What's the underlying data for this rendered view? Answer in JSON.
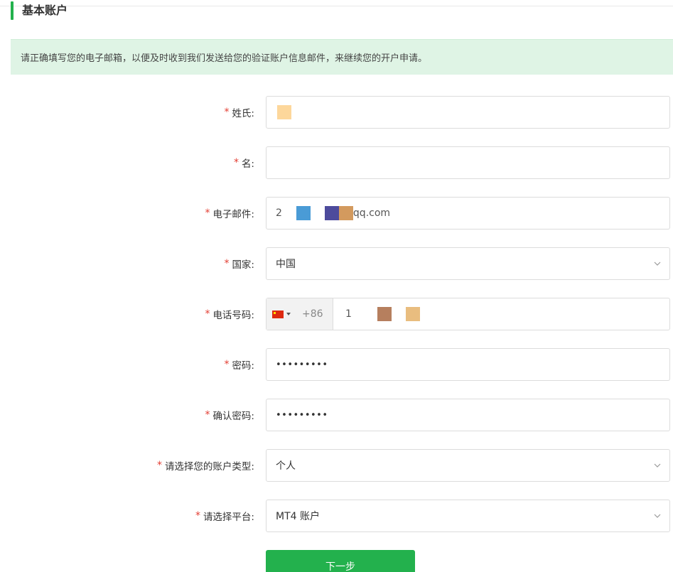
{
  "section": {
    "title": "基本账户"
  },
  "notice": {
    "text": "请正确填写您的电子邮箱，以便及时收到我们发送给您的验证账户信息邮件，来继续您的开户申请。"
  },
  "form": {
    "required_mark": "*",
    "last_name": {
      "label": "姓氏:",
      "value": ""
    },
    "first_name": {
      "label": "名:",
      "value": ""
    },
    "email": {
      "label": "电子邮件:",
      "value_prefix": "2",
      "value_suffix": "qq.com"
    },
    "country": {
      "label": "国家:",
      "value": "中国"
    },
    "phone": {
      "label": "电话号码:",
      "flag_icon": "china-flag-icon",
      "country_code": "+86",
      "value_prefix": "1"
    },
    "password": {
      "label": "密码:",
      "value": "•••••••••"
    },
    "confirm_password": {
      "label": "确认密码:",
      "value": "•••••••••"
    },
    "account_type": {
      "label": "请选择您的账户类型:",
      "value": "个人"
    },
    "platform": {
      "label": "请选择平台:",
      "value": "MT4 账户"
    }
  },
  "actions": {
    "next_label": "下一步"
  },
  "colors": {
    "accent": "#23b14d",
    "notice_bg": "#dff4e5",
    "required": "#e33e33",
    "redaction_1": "#fdd79b",
    "redaction_2": "#4a9bd6",
    "redaction_3": "#4d4b9c",
    "redaction_4": "#d39a5e",
    "redaction_5": "#b67f5e",
    "redaction_6": "#e9bd7f"
  },
  "icons": {
    "select_arrow": "chevron-down-icon"
  }
}
